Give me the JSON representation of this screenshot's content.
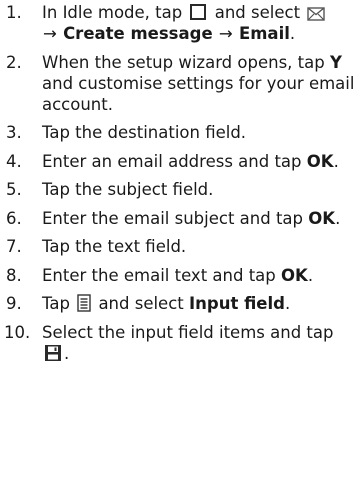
{
  "steps": [
    {
      "num": "1.",
      "line1_pre": "In Idle mode, tap",
      "line1_mid": "and select",
      "arrow1": "→",
      "create_message": "Create message",
      "arrow2": "→",
      "email": "Email",
      "period": ".",
      "icons": [
        "menu-square-icon",
        "envelope-icon"
      ]
    },
    {
      "num": "2.",
      "text_pre": "When the setup wizard opens, tap",
      "y": "Y",
      "text_post": "and customise settings for your email account."
    },
    {
      "num": "3.",
      "text": "Tap the destination field."
    },
    {
      "num": "4.",
      "text_pre": "Enter an email address and tap",
      "ok": "OK",
      "period": "."
    },
    {
      "num": "5.",
      "text": "Tap the subject field."
    },
    {
      "num": "6.",
      "text_pre": "Enter the email subject and tap",
      "ok": "OK",
      "period": "."
    },
    {
      "num": "7.",
      "text": "Tap the text field."
    },
    {
      "num": "8.",
      "text_pre": "Enter the email text and tap",
      "ok": "OK",
      "period": "."
    },
    {
      "num": "9.",
      "text_pre": "Tap",
      "text_mid": "and select",
      "input_field": "Input field",
      "period": ".",
      "icons": [
        "options-list-icon"
      ]
    },
    {
      "num": "10.",
      "text_pre": "Select the input field items and tap",
      "period": ".",
      "icons": [
        "save-icon"
      ]
    }
  ]
}
